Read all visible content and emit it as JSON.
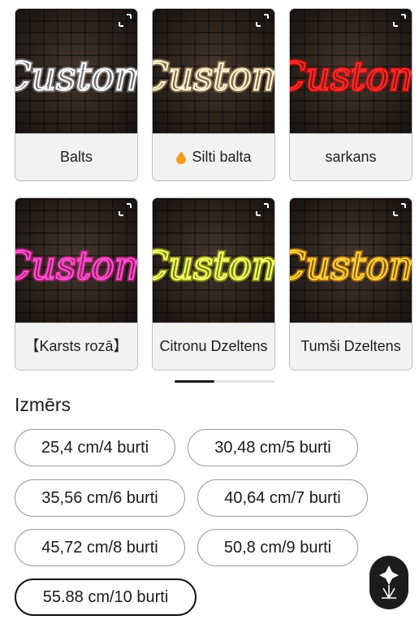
{
  "colors": {
    "items": [
      {
        "label": "Balts",
        "neon": "#ffffff",
        "glow": "#e8f0ff",
        "icon": null
      },
      {
        "label": "Silti balta",
        "neon": "#fff3d6",
        "glow": "#ffd38a",
        "icon": "fire-icon"
      },
      {
        "label": "sarkans",
        "neon": "#ff2a2a",
        "glow": "#ff0000",
        "icon": null
      },
      {
        "label": "【Karsts rozā】",
        "neon": "#ff4fd0",
        "glow": "#ff1aa8",
        "icon": null
      },
      {
        "label": "Citronu Dzeltens",
        "neon": "#f6ff6a",
        "glow": "#d8f000",
        "icon": null
      },
      {
        "label": "Tumši Dzeltens",
        "neon": "#ffd23a",
        "glow": "#ff9d00",
        "icon": null
      }
    ],
    "neon_text": "Custom"
  },
  "size": {
    "title": "Izmērs",
    "options": [
      {
        "label": "25,4 cm/4 burti",
        "selected": false
      },
      {
        "label": "30,48 cm/5 burti",
        "selected": false
      },
      {
        "label": "35,56 cm/6 burti",
        "selected": false
      },
      {
        "label": "40,64 cm/7 burti",
        "selected": false
      },
      {
        "label": "45,72 cm/8 burti",
        "selected": false
      },
      {
        "label": "50,8 cm/9 burti",
        "selected": false
      },
      {
        "label": "55.88 cm/10 burti",
        "selected": true
      }
    ]
  },
  "carousel_indicator": {
    "position": 0.0,
    "visible_fraction": 0.4
  },
  "fab": {
    "icon": "brand-logo-icon"
  }
}
